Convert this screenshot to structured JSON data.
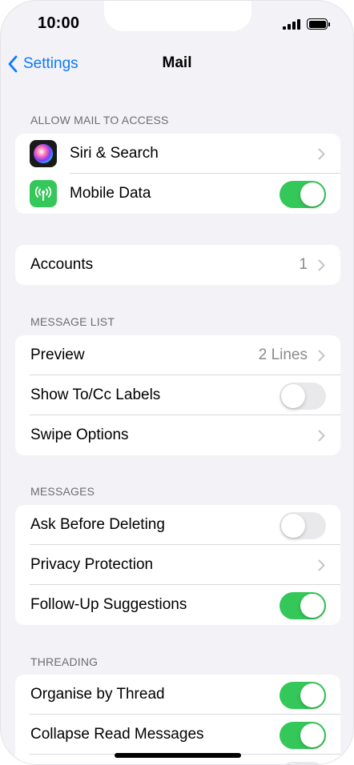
{
  "status_bar": {
    "time": "10:00"
  },
  "nav": {
    "back_label": "Settings",
    "title": "Mail"
  },
  "sections": {
    "allow_access": {
      "header": "ALLOW MAIL TO ACCESS",
      "siri": {
        "label": "Siri & Search"
      },
      "mobile_data": {
        "label": "Mobile Data",
        "enabled": true
      }
    },
    "accounts": {
      "label": "Accounts",
      "value": "1"
    },
    "message_list": {
      "header": "MESSAGE LIST",
      "preview": {
        "label": "Preview",
        "value": "2 Lines"
      },
      "show_to_cc": {
        "label": "Show To/Cc Labels",
        "enabled": false
      },
      "swipe_options": {
        "label": "Swipe Options"
      }
    },
    "messages": {
      "header": "MESSAGES",
      "ask_before_deleting": {
        "label": "Ask Before Deleting",
        "enabled": false
      },
      "privacy_protection": {
        "label": "Privacy Protection"
      },
      "follow_up": {
        "label": "Follow-Up Suggestions",
        "enabled": true
      }
    },
    "threading": {
      "header": "THREADING",
      "organise_by_thread": {
        "label": "Organise by Thread",
        "enabled": true
      },
      "collapse_read": {
        "label": "Collapse Read Messages",
        "enabled": true
      }
    }
  },
  "colors": {
    "accent": "#0a7aff",
    "toggle_on": "#34c759",
    "background": "#f2f2f7"
  },
  "icons": {
    "back": "chevron-left-icon",
    "disclosure": "chevron-right-icon",
    "siri": "siri-icon",
    "mobile_data": "antenna-icon"
  }
}
